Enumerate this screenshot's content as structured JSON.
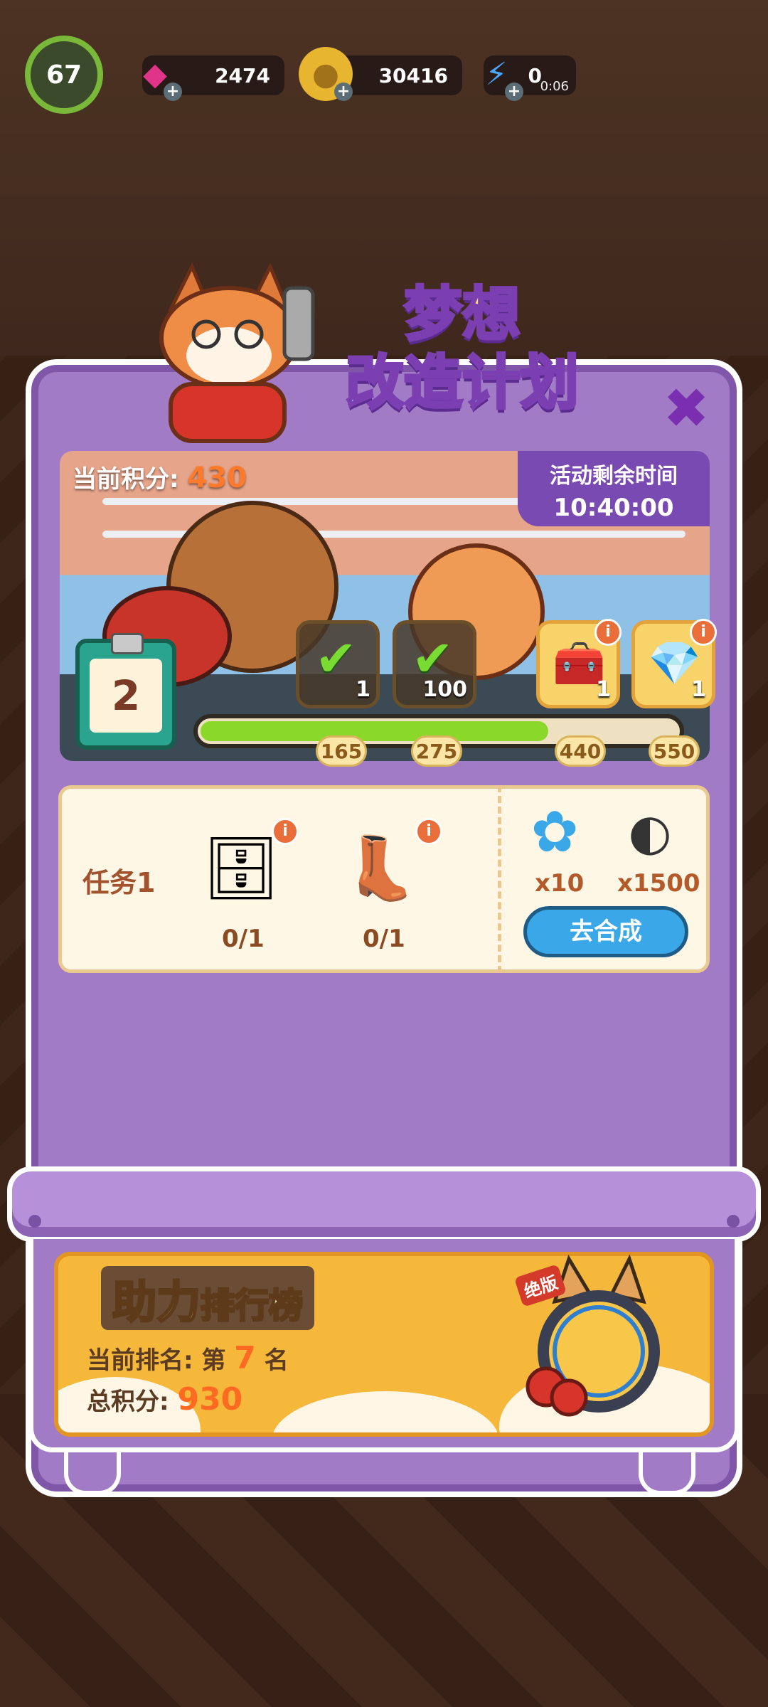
{
  "hud": {
    "level": "67",
    "gems": "2474",
    "coins": "30416",
    "energy": "0",
    "energy_timer": "0:06",
    "icons": [
      "level-badge-icon",
      "gem-icon",
      "coin-icon",
      "energy-bolt-icon"
    ]
  },
  "event": {
    "title_line1": "梦想",
    "title_line2": "改造计划",
    "score_label": "当前积分:",
    "score_value": "430",
    "timer_label": "活动剩余时间",
    "timer_value": "10:40:00",
    "stage": "2",
    "progress_fraction": 0.73,
    "rewards": [
      {
        "state": "claimed",
        "qty": "1"
      },
      {
        "state": "claimed",
        "qty": "100"
      },
      {
        "state": "locked",
        "icon": "wooden-chest-icon",
        "qty": "1"
      },
      {
        "state": "locked",
        "icon": "blue-chest-icon",
        "qty": "1"
      }
    ],
    "milestones": [
      "165",
      "275",
      "440",
      "550"
    ]
  },
  "task": {
    "title": "任务1",
    "items": [
      {
        "icon": "glass-cabinet-icon",
        "count": "0/1"
      },
      {
        "icon": "boots-icon",
        "count": "0/1"
      }
    ],
    "rewards": [
      {
        "icon": "blue-flower-icon",
        "qty": "x10"
      },
      {
        "icon": "sunflower-seeds-icon",
        "qty": "x1500"
      }
    ],
    "button_label": "去合成"
  },
  "leaderboard": {
    "title_big": "助力",
    "title_small": "排行榜",
    "rank_label": "当前排名:",
    "rank_prefix": "第",
    "rank_value": "7",
    "rank_suffix": "名",
    "total_label": "总积分:",
    "total_value": "930",
    "exclusive_tag": "绝版"
  },
  "colors": {
    "panel_purple": "#a27bc6",
    "accent_orange": "#ff6a22",
    "progress_green": "#8ad82a",
    "button_blue": "#3aa8e8"
  }
}
